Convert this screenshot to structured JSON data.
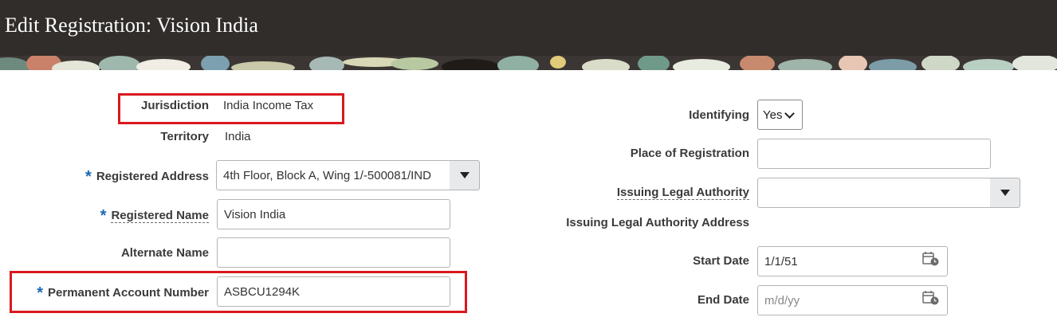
{
  "page": {
    "title": "Edit Registration: Vision India"
  },
  "left": {
    "jurisdiction": {
      "label": "Jurisdiction",
      "value": "India Income Tax"
    },
    "territory": {
      "label": "Territory",
      "value": "India"
    },
    "registered_address": {
      "label": "Registered Address",
      "required_mark": "*",
      "value": "4th Floor, Block A, Wing 1/-500081/IND"
    },
    "registered_name": {
      "label": "Registered Name",
      "required_mark": "*",
      "value": "Vision India"
    },
    "alternate_name": {
      "label": "Alternate Name",
      "value": ""
    },
    "pan": {
      "label": "Permanent Account Number",
      "required_mark": "*",
      "value": "ASBCU1294K"
    }
  },
  "right": {
    "identifying": {
      "label": "Identifying",
      "value": "Yes"
    },
    "place_of_registration": {
      "label": "Place of Registration",
      "value": ""
    },
    "issuing_legal_authority": {
      "label": "Issuing Legal Authority",
      "value": ""
    },
    "issuing_legal_authority_address": {
      "label": "Issuing Legal Authority Address"
    },
    "start_date": {
      "label": "Start Date",
      "value": "1/1/51"
    },
    "end_date": {
      "label": "End Date",
      "placeholder": "m/d/yy",
      "value": ""
    }
  },
  "colors": {
    "header_bg": "#312d2a",
    "required_marker": "#1a67b2",
    "highlight_box": "#d9191f"
  },
  "icons": {
    "calendar": "calendar-icon",
    "dropdown": "caret-down-icon"
  }
}
